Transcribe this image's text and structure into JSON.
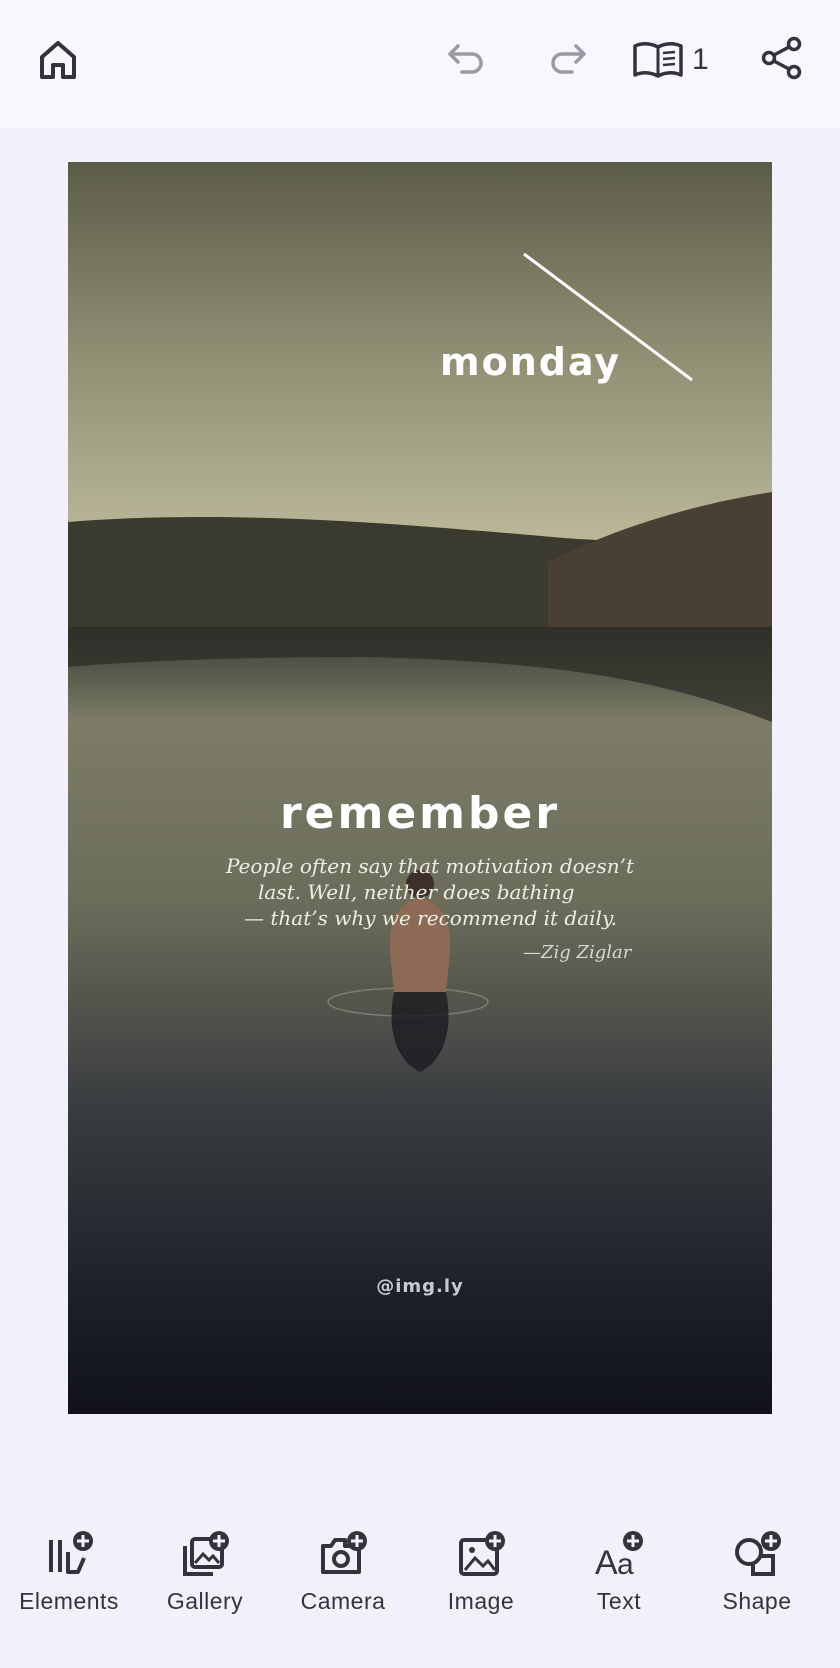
{
  "header": {
    "page_count": "1"
  },
  "canvas": {
    "monday": "monday",
    "remember": "remember",
    "quote": {
      "line1": "People often say that motivation doesn’t",
      "line2": "last. Well, neither does bathing",
      "line3": "— that’s why we recommend it daily."
    },
    "author": "—Zig Ziglar",
    "handle": "@img.ly"
  },
  "toolbar": {
    "items": [
      {
        "label": "Elements",
        "icon": "elements-add-icon"
      },
      {
        "label": "Gallery",
        "icon": "gallery-add-icon"
      },
      {
        "label": "Camera",
        "icon": "camera-add-icon"
      },
      {
        "label": "Image",
        "icon": "image-add-icon"
      },
      {
        "label": "Text",
        "icon": "text-add-icon"
      },
      {
        "label": "Shape",
        "icon": "shape-add-icon"
      }
    ]
  },
  "colors": {
    "background": "#f1f0fb",
    "topbar": "#f8f7fd",
    "icon": "#33333f",
    "icon_disabled": "#9a9aa4"
  }
}
